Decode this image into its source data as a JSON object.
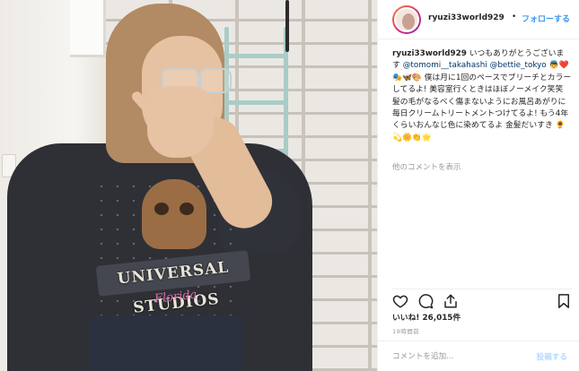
{
  "header": {
    "username": "ryuzi33world929",
    "separator": "•",
    "follow_label": "フォローする"
  },
  "caption": {
    "username": "ryuzi33world929",
    "line1": "いつもありがとうございます",
    "mention1": "@tomomi__takahashi",
    "mention2": "@bettie_tokyo",
    "body": "👼❤️🎭🦋🎨 僕は月に1回のペースでブリーチとカラーしてるよ! 美容室行くときはほぼノーメイク笑笑 髪の毛がなるべく傷まないようにお風呂あがりに毎日クリームトリートメントつけてるよ! もう4年くらいおんなじ色に染めてるよ 金髪だいすき",
    "emoji_tail": "🌻💫🌼👏🌟"
  },
  "comments": {
    "view_more": "他のコメントを表示"
  },
  "actions": {
    "like_icon": "heart-icon",
    "comment_icon": "comment-icon",
    "share_icon": "share-icon",
    "save_icon": "bookmark-icon"
  },
  "stats": {
    "likes_label": "いいね!",
    "likes_count": "26,015件",
    "time_ago": "19時間前"
  },
  "comment_input": {
    "placeholder": "コメントを追加...",
    "post_label": "投稿する"
  },
  "photo": {
    "shirt_print_title": "UNIVERSAL STUDIOS",
    "shirt_print_subtitle": "Florida"
  },
  "colors": {
    "follow_blue": "#3897f0",
    "text": "#262626",
    "muted": "#999999"
  }
}
